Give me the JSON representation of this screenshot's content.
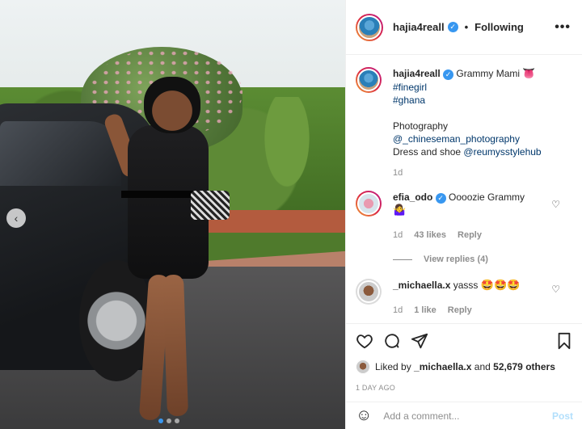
{
  "post": {
    "author": "hajia4reall",
    "follow_status": "Following",
    "separator": "•",
    "more": "•••",
    "caption_text": "Grammy Mami",
    "caption_emoji": "👅",
    "hashtags": [
      "#finegirl",
      "#ghana"
    ],
    "credits_heading": "Photography",
    "photographer_tag": "@_chineseman_photography",
    "dress_prefix": "Dress and shoe",
    "stylist_tag": "@reumysstylehub",
    "caption_time": "1d"
  },
  "comments": [
    {
      "user": "efia_odo",
      "verified": true,
      "text": "Oooozie Grammy",
      "emoji": "🤷‍♀️",
      "time": "1d",
      "likes": "43 likes",
      "reply": "Reply",
      "view_replies": "View replies (4)"
    },
    {
      "user": "_michaella.x",
      "verified": false,
      "text": "yasss",
      "emoji": "🤩🤩🤩",
      "time": "1d",
      "likes": "1 like",
      "reply": "Reply"
    }
  ],
  "likes_summary": {
    "prefix": "Liked by",
    "user": "_michaella.x",
    "middle": "and",
    "count": "52,679 others"
  },
  "timestamp": "1 DAY AGO",
  "comment_box": {
    "placeholder": "Add a comment...",
    "post_label": "Post"
  },
  "carousel": {
    "prev_icon": "‹",
    "slides": 3,
    "active_index": 0
  },
  "colors": {
    "accent": "#3897f0",
    "link": "#00376b",
    "muted": "#8e8e8e"
  }
}
